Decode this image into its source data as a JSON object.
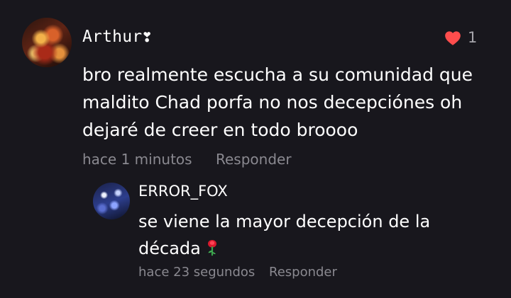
{
  "comment": {
    "username": "Arthur❣",
    "text": "bro realmente escucha a su comunidad que maldito Chad porfa no nos decepciónes oh dejaré de creer en todo broooo",
    "timestamp": "hace 1 minutos",
    "reply_label": "Responder",
    "likes": "1",
    "heart_icon": "heart-icon",
    "accent_color": "#ff4d4d"
  },
  "reply": {
    "username": "ERROR_FOX",
    "text": "se viene la mayor decepción de la década",
    "emoji_icon": "rose-icon",
    "timestamp": "hace 23 segundos",
    "reply_label": "Responder"
  }
}
